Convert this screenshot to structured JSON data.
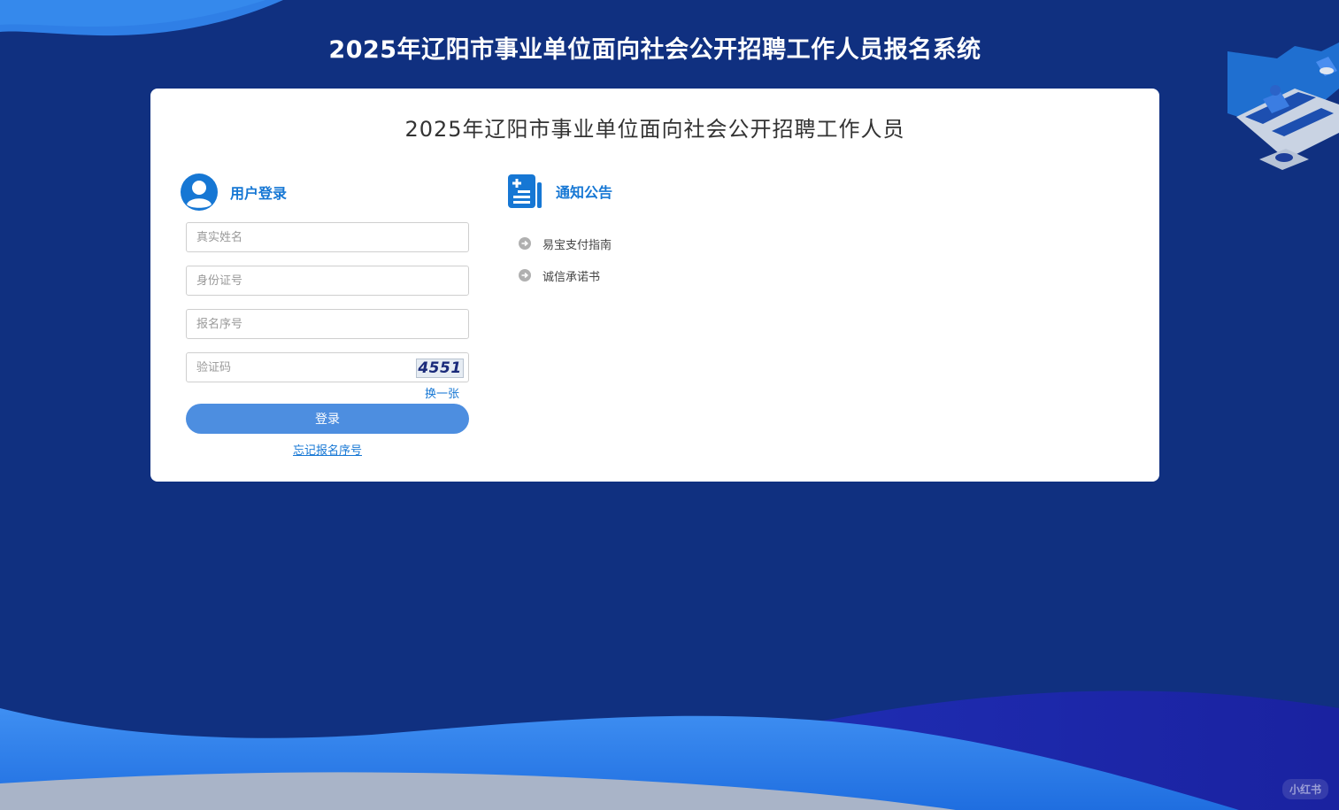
{
  "header": {
    "site_title": "2025年辽阳市事业单位面向社会公开招聘工作人员报名系统"
  },
  "card": {
    "title": "2025年辽阳市事业单位面向社会公开招聘工作人员"
  },
  "login": {
    "heading": "用户登录",
    "name_placeholder": "真实姓名",
    "id_placeholder": "身份证号",
    "serial_placeholder": "报名序号",
    "captcha_placeholder": "验证码",
    "captcha_code": "4551",
    "refresh_label": "换一张",
    "login_button": "登录",
    "forgot_link": "忘记报名序号"
  },
  "notices": {
    "heading": "通知公告",
    "items": [
      {
        "label": "易宝支付指南"
      },
      {
        "label": "诚信承诺书"
      }
    ]
  },
  "watermark": "小红书",
  "colors": {
    "background": "#103080",
    "accent": "#1677d4",
    "button": "#4d8ee0"
  },
  "icons": {
    "login": "user-avatar-icon",
    "notice": "document-list-icon",
    "notice_item": "arrow-circle-icon"
  }
}
